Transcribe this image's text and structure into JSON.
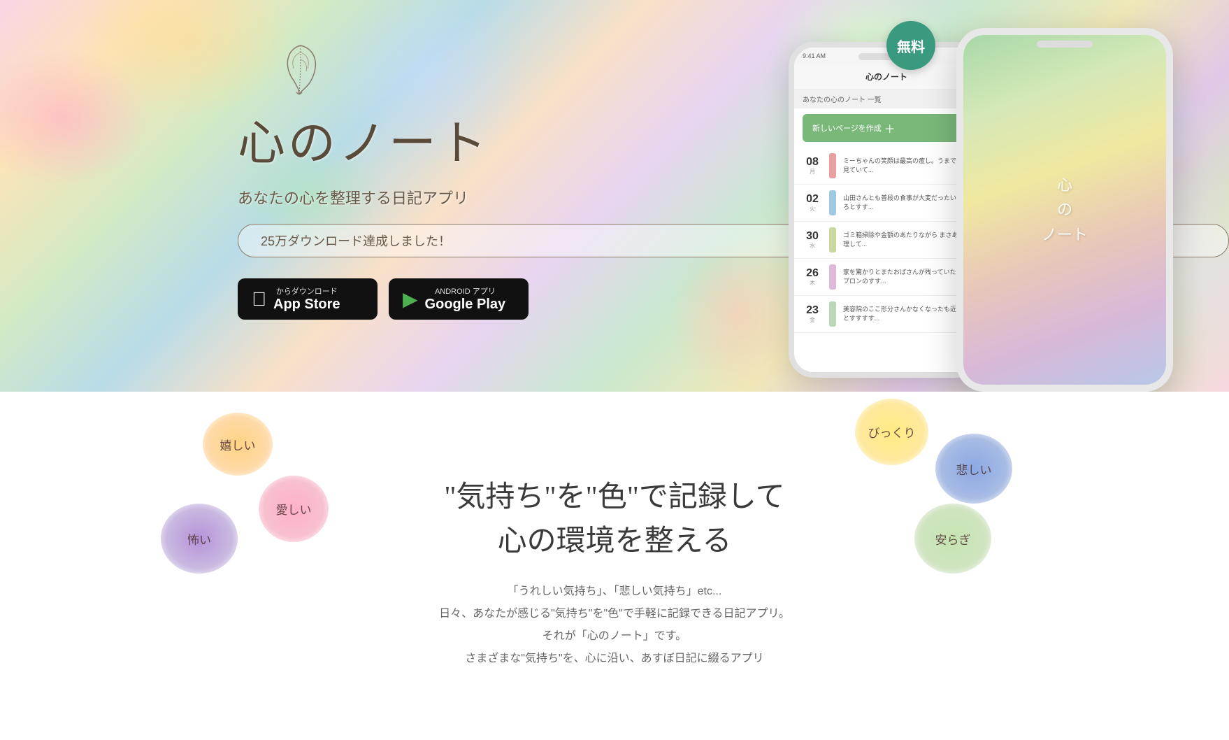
{
  "hero": {
    "feather_alt": "feather icon",
    "app_title": "心のノート",
    "app_subtitle": "あなたの心を整理する日記アプリ",
    "download_badge": "25万ダウンロード達成しました！",
    "free_badge": "無料",
    "app_store_sub": "App Store",
    "app_store_sub_label": "からダウンロード",
    "app_store_main": "App Store",
    "google_play_sub": "ANDROID アプリ",
    "google_play_main": "Google Play"
  },
  "phone_back": {
    "title_line1": "心",
    "title_line2": "の",
    "title_line3": "ノート"
  },
  "phone_front": {
    "status_time": "9:41 AM",
    "status_battery": "|||",
    "nav_title": "心のノート",
    "list_header": "あなたの心のノート 一覧",
    "add_btn": "新しいページを作成",
    "entries": [
      {
        "day": "08",
        "weekday": "月",
        "color": "#e8a0a0",
        "text": "ミーちゃんの笑顔は最高の癒し。うまでも気見ていて..."
      },
      {
        "day": "02",
        "weekday": "火",
        "color": "#a0c8e0",
        "text": "山田さんとも普段の食事が大変だった。いろいろちょっかがすすすす..."
      },
      {
        "day": "30",
        "weekday": "水",
        "color": "#c8d8a0",
        "text": "ゴミ箱掃除や金額のあたりながら まさあ整理して..."
      },
      {
        "day": "26",
        "weekday": "木",
        "color": "#e0b8d8",
        "text": "家を驚かりとまたおばさんが残っていたのアプロンのすす..."
      },
      {
        "day": "23",
        "weekday": "金",
        "color": "#b8d8b8",
        "text": "美容院のここ形分さんかなくなったも 近いいとすすすす..."
      }
    ]
  },
  "features": {
    "heading_line1": "\"気持ち\"を\"色\"で記録して",
    "heading_line2": "心の環境を整える",
    "desc_line1": "「うれしい気持ち」、「悲しい気持ち」etc...",
    "desc_line2": "日々、あなたが感じる\"気持ち\"を\"色\"で手軽に記録できる日記アプリ。",
    "desc_line3": "それが「心のノート」です。",
    "desc_line4": "さまざまな\"気持ち\"を、心に沿い、あすぼ日記に綴るアプリ"
  },
  "emotions": {
    "ureshii": "嬉しい",
    "kowai": "怖い",
    "itoshii": "愛しい",
    "bikkuri": "びっくり",
    "kanashii": "悲しい",
    "yasuragi": "安らぎ"
  }
}
